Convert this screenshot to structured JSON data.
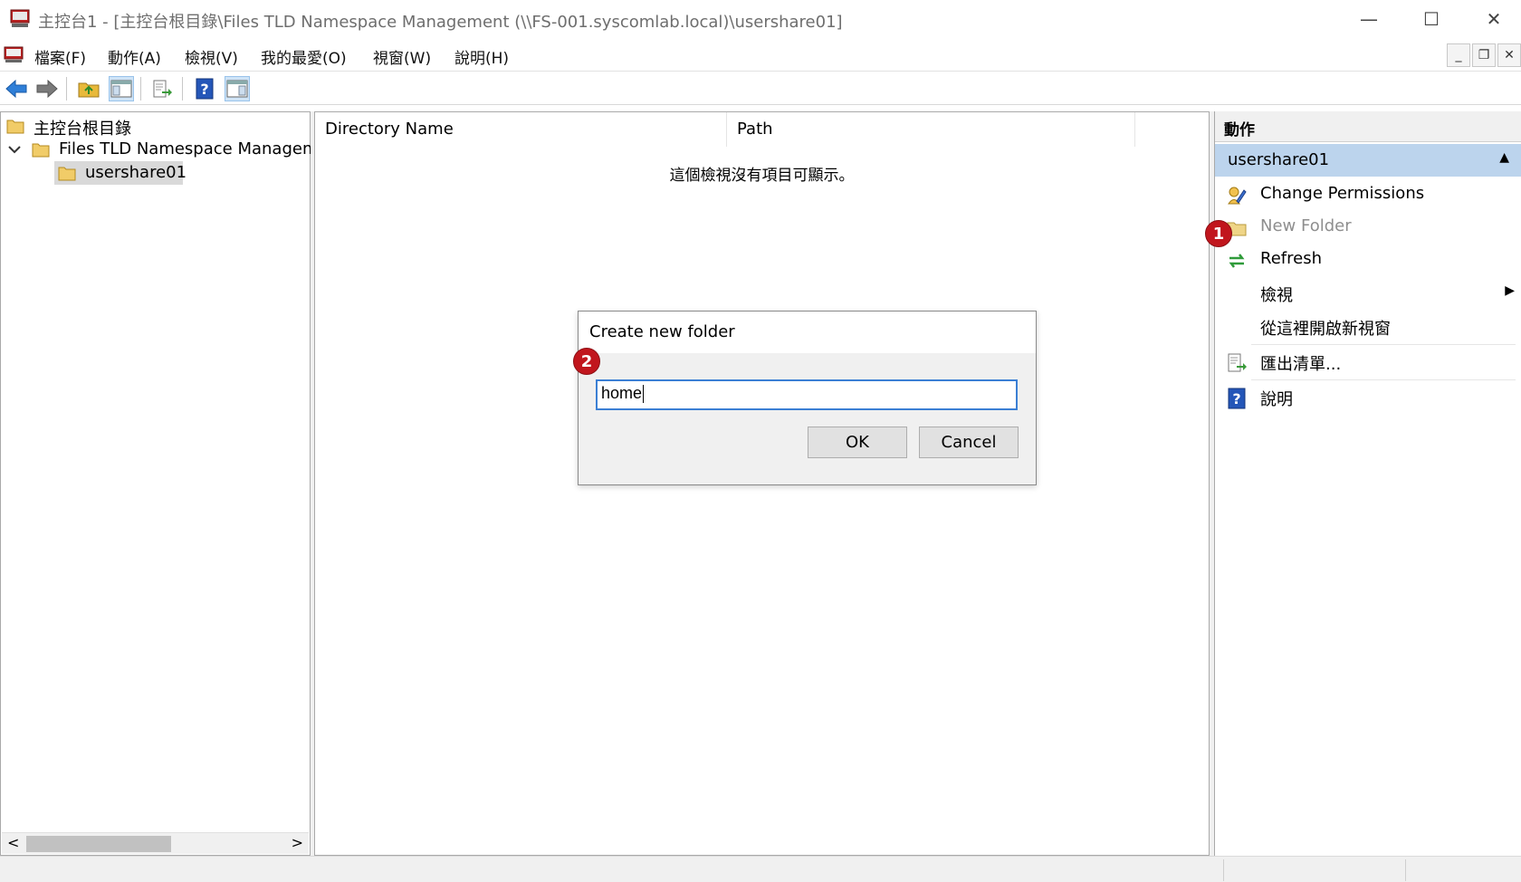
{
  "window": {
    "title": "主控台1 - [主控台根目錄\\Files TLD Namespace Management (\\\\FS-001.syscomlab.local)\\usershare01]",
    "minimize_glyph": "—",
    "maximize_glyph": "☐",
    "close_glyph": "✕"
  },
  "menubar": {
    "items": [
      "檔案(F)",
      "動作(A)",
      "檢視(V)",
      "我的最愛(O)",
      "視窗(W)",
      "說明(H)"
    ],
    "mdi_minimize": "_",
    "mdi_restore": "❐",
    "mdi_close": "✕"
  },
  "tree": {
    "root": "主控台根目錄",
    "child": "Files TLD Namespace Managem",
    "leaf": "usershare01",
    "scroll_left": "<",
    "scroll_right": ">"
  },
  "list": {
    "columns": [
      "Directory Name",
      "Path"
    ],
    "empty_message": "這個檢視沒有項目可顯示。"
  },
  "actions": {
    "header": "動作",
    "section": "usershare01",
    "items": [
      {
        "label": "Change Permissions",
        "icon": "permissions-icon"
      },
      {
        "label": "New Folder",
        "icon": "new-folder-icon"
      },
      {
        "label": "Refresh",
        "icon": "refresh-icon"
      },
      {
        "label": "檢視",
        "icon": ""
      },
      {
        "label": "從這裡開啟新視窗",
        "icon": ""
      },
      {
        "label": "匯出清單...",
        "icon": "export-list-icon"
      },
      {
        "label": "說明",
        "icon": "help-icon"
      }
    ]
  },
  "dialog": {
    "title": "Create new folder",
    "input_value": "home",
    "ok_label": "OK",
    "cancel_label": "Cancel"
  },
  "badges": {
    "one": "1",
    "two": "2",
    "color": "#c1161d"
  },
  "colors": {
    "selection_blue": "#bcd4ed",
    "input_focus": "#3b7fd4"
  }
}
